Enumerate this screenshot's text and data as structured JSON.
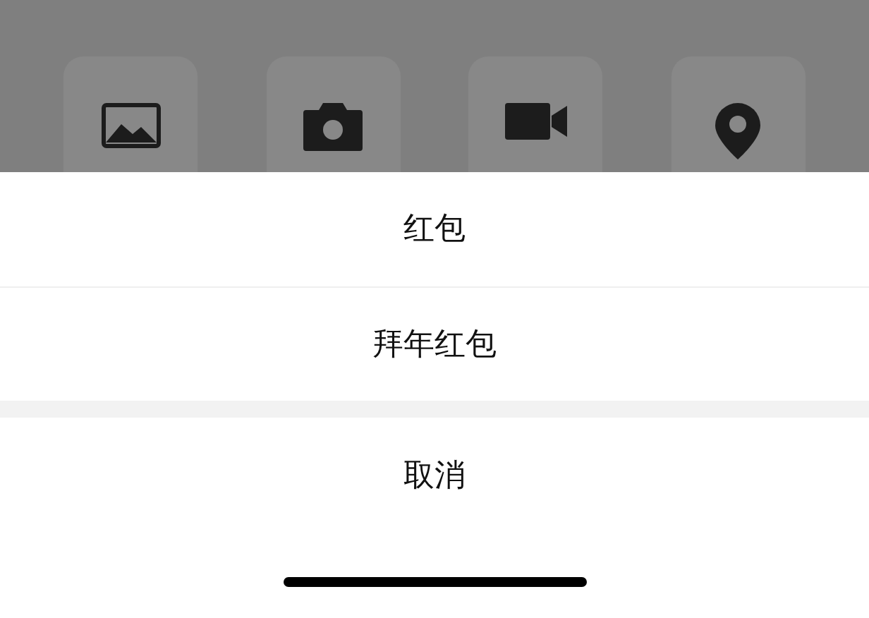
{
  "action_sheet": {
    "options": [
      {
        "label": "红包"
      },
      {
        "label": "拜年红包"
      }
    ],
    "cancel": {
      "label": "取消"
    }
  }
}
